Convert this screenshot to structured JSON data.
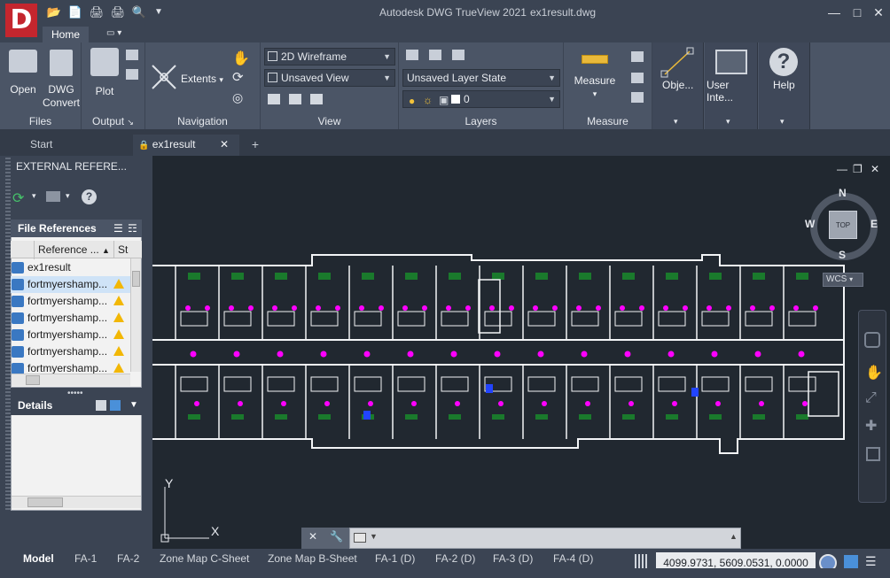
{
  "app": {
    "title": "Autodesk DWG TrueView 2021",
    "file_title": "ex1result.dwg",
    "logo_letter": "D"
  },
  "ribbon": {
    "tabs": [
      {
        "label": "Home"
      }
    ],
    "panels": {
      "files": {
        "label": "Files",
        "open": "Open",
        "dwg_convert_line1": "DWG",
        "dwg_convert_line2": "Convert"
      },
      "output": {
        "label": "Output",
        "plot": "Plot"
      },
      "navigation": {
        "label": "Navigation",
        "extents": "Extents"
      },
      "view": {
        "label": "View",
        "visual_style": "2D Wireframe",
        "named_view": "Unsaved View"
      },
      "layers": {
        "label": "Layers",
        "layer_state": "Unsaved Layer State",
        "current_layer": "0"
      },
      "measure": {
        "label": "Measure",
        "measure": "Measure"
      },
      "extra": {
        "objects": "Obje...",
        "user_interface": "User Inte...",
        "help": "Help"
      }
    }
  },
  "doc_tabs": {
    "start": "Start",
    "current": "ex1result"
  },
  "palette": {
    "title": "EXTERNAL REFERE...",
    "file_refs_header": "File References",
    "col_reference": "Reference ...",
    "col_status": "St",
    "refs": [
      {
        "name": "ex1result",
        "warning": false
      },
      {
        "name": "fortmyershamp...",
        "warning": true
      },
      {
        "name": "fortmyershamp...",
        "warning": true
      },
      {
        "name": "fortmyershamp...",
        "warning": true
      },
      {
        "name": "fortmyershamp...",
        "warning": true
      },
      {
        "name": "fortmyershamp...",
        "warning": true
      },
      {
        "name": "fortmyershamp...",
        "warning": true
      }
    ],
    "details_header": "Details"
  },
  "viewcube": {
    "north": "N",
    "south": "S",
    "east": "E",
    "west": "W",
    "face": "TOP",
    "ucs": "WCS"
  },
  "ucs_axes": {
    "x": "X",
    "y": "Y"
  },
  "layout_tabs": [
    {
      "label": "Model",
      "active": true
    },
    {
      "label": "FA-1"
    },
    {
      "label": "FA-2"
    },
    {
      "label": "Zone Map C-Sheet"
    },
    {
      "label": "Zone Map B-Sheet"
    },
    {
      "label": "FA-1 (D)"
    },
    {
      "label": "FA-2 (D)"
    },
    {
      "label": "FA-3 (D)"
    },
    {
      "label": "FA-4 (D)"
    }
  ],
  "status": {
    "coordinates": "4099.9731, 5609.0531, 0.0000"
  },
  "colors": {
    "accent_red": "#c4262e",
    "canvas_bg": "#212830",
    "walls": "#f2f4f6",
    "devices_magenta": "#ff00ff",
    "devices_blue": "#2244ff",
    "labels_green": "#1a7a2c"
  }
}
